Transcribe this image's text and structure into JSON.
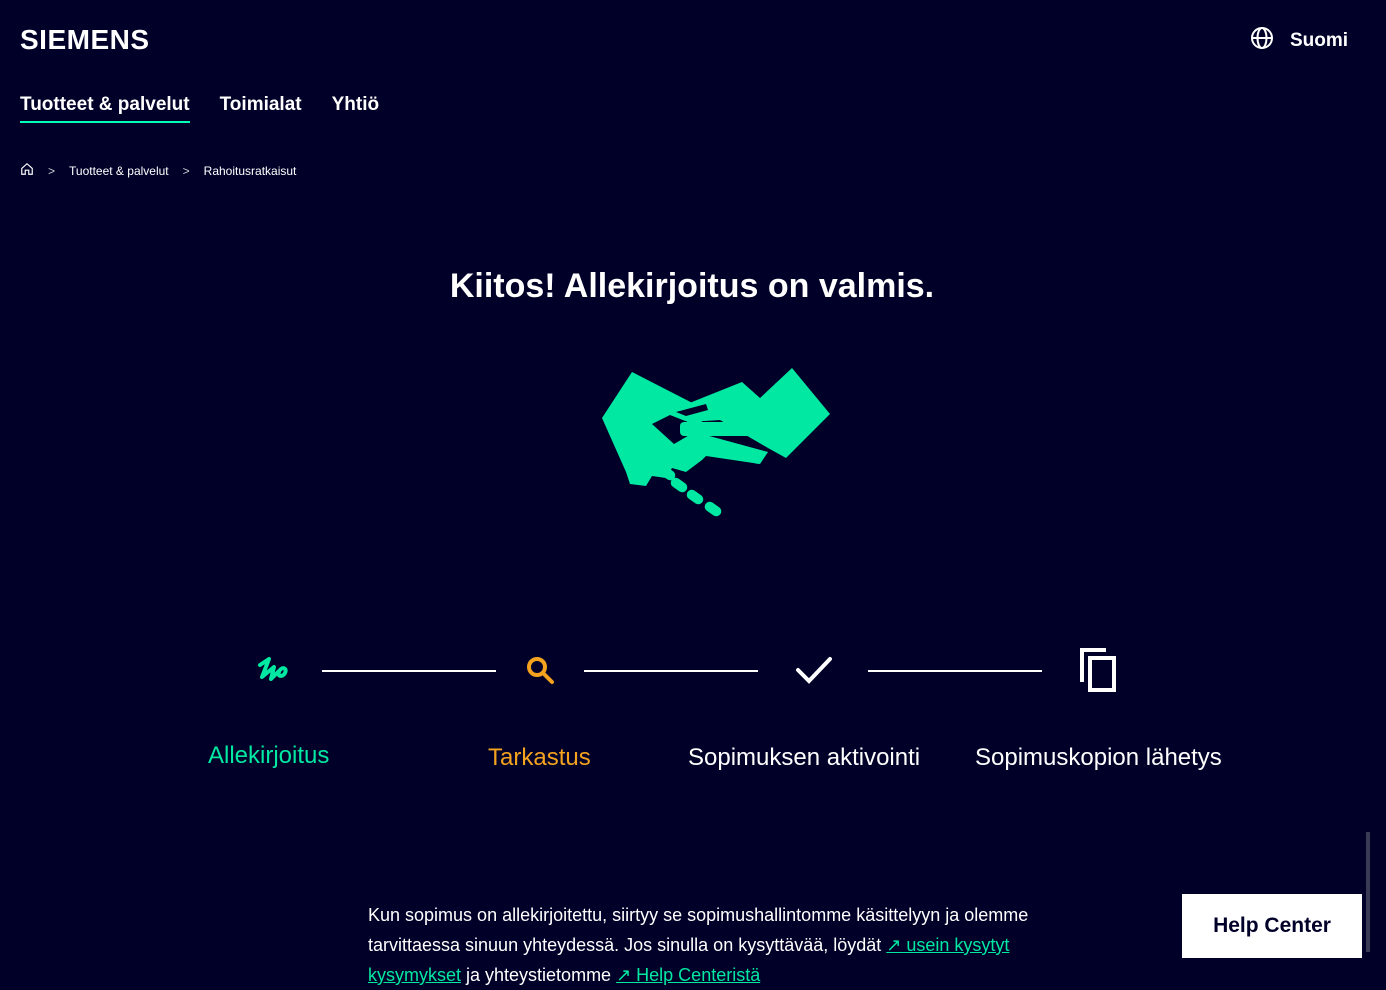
{
  "header": {
    "logo": "SIEMENS",
    "language": "Suomi",
    "language_icon": "globe-icon"
  },
  "nav": {
    "items": [
      {
        "label": "Tuotteet & palvelut",
        "active": true
      },
      {
        "label": "Toimialat",
        "active": false
      },
      {
        "label": "Yhtiö",
        "active": false
      }
    ]
  },
  "breadcrumb": {
    "home_icon": "home-icon",
    "items": [
      "Tuotteet & palvelut",
      "Rahoitusratkaisut"
    ]
  },
  "main": {
    "title": "Kiitos! Allekirjoitus on valmis.",
    "illustration": "handshake-icon"
  },
  "steps": [
    {
      "label": "Allekirjoitus",
      "icon": "signature-icon",
      "color": "#00e8a2"
    },
    {
      "label": "Tarkastus",
      "icon": "search-icon",
      "color": "#f4a31e"
    },
    {
      "label": "Sopimuksen aktivointi",
      "icon": "check-icon",
      "color": "#ffffff"
    },
    {
      "label": "Sopimuskopion lähetys",
      "icon": "copy-icon",
      "color": "#ffffff"
    }
  ],
  "info": {
    "text_before": "Kun sopimus on allekirjoitettu, siirtyy se sopimushallintomme käsittelyyn ja olemme tarvittaessa sinuun yhteydessä. Jos sinulla on kysyttävää, löydät ",
    "link1": "↗ usein kysytyt kysymykset",
    "text_middle": " ja yhteystietomme ",
    "link2": "↗ Help Centeristä"
  },
  "help_button": "Help Center",
  "colors": {
    "background": "#000028",
    "accent": "#00ffb9",
    "link": "#00e8a2",
    "review": "#f4a31e"
  }
}
